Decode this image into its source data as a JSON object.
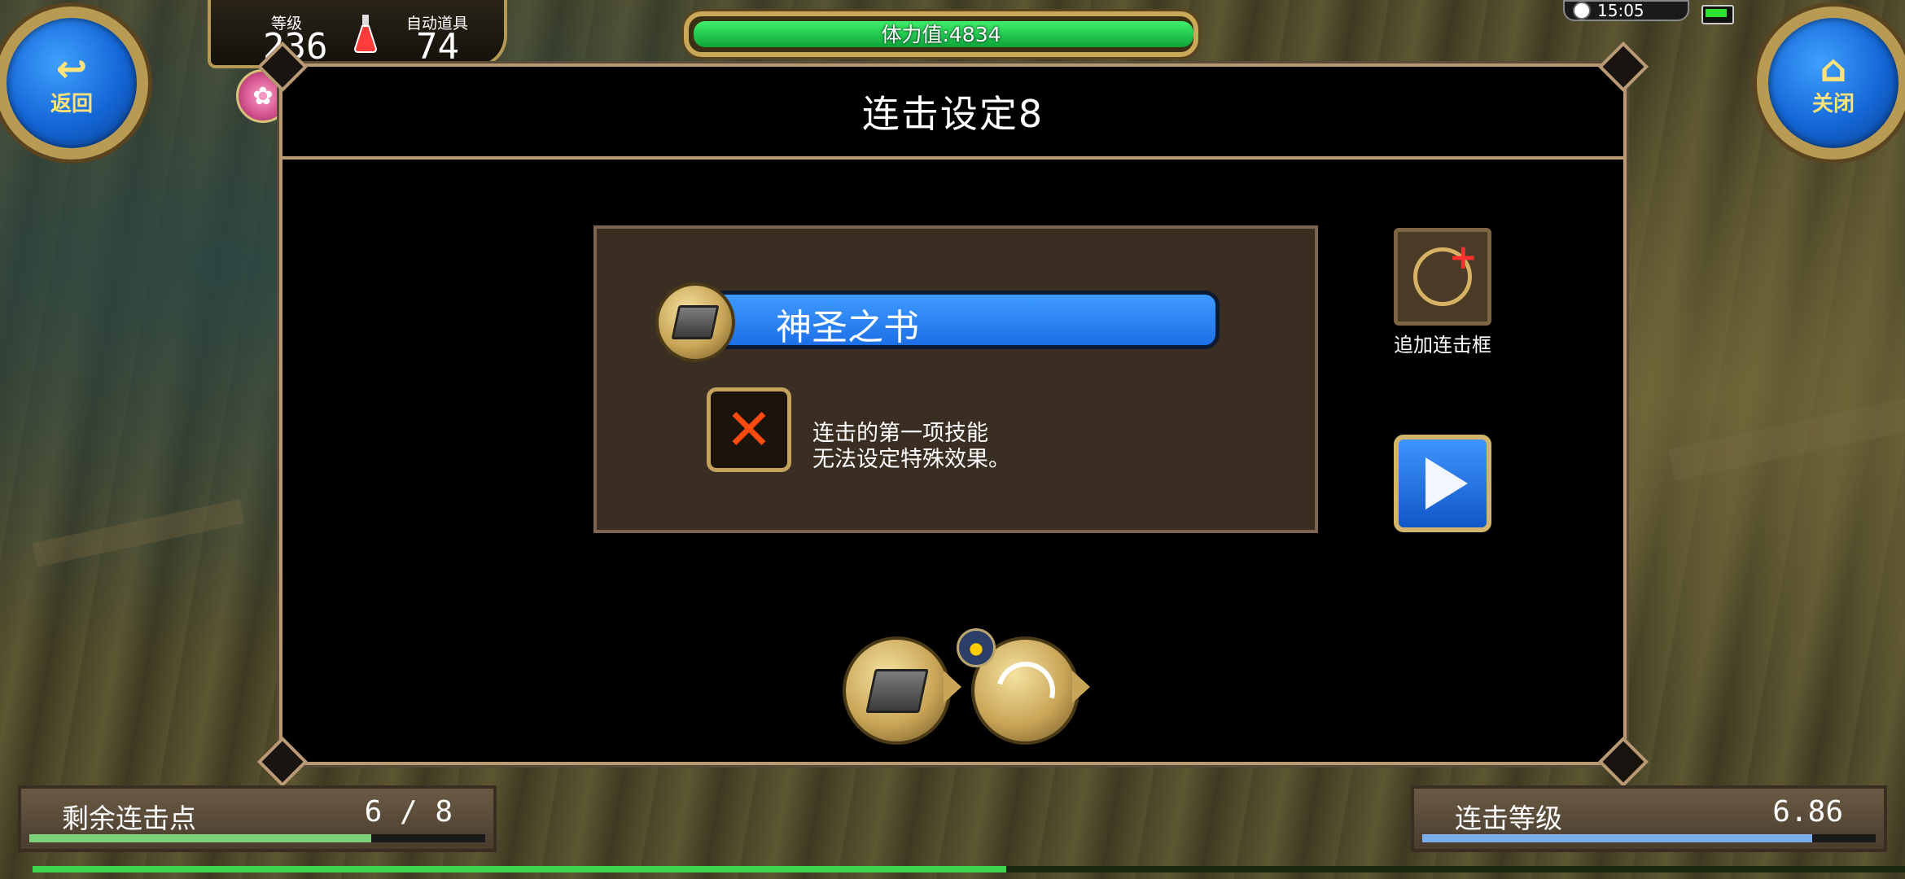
{
  "nav": {
    "back_label": "返回",
    "close_label": "关闭"
  },
  "hud": {
    "level_label": "等级",
    "level_value": "236",
    "auto_item_label": "自动道具",
    "auto_item_value": "74",
    "stamina_text": "体力值:4834",
    "stamina_fraction": 1.0,
    "clock": "15:05"
  },
  "dialog": {
    "title": "连击设定8",
    "skill_name": "神圣之书",
    "note_line1": "连击的第一项技能",
    "note_line2": "无法设定特殊效果。",
    "add_combo_label": "追加连击框"
  },
  "combo_slots": [
    {
      "icon": "book-icon"
    },
    {
      "icon": "slash-skill-icon"
    }
  ],
  "bottom": {
    "remaining_label": "剩余连击点",
    "remaining_value": "6 / 8",
    "remaining_fraction": 0.75,
    "combo_level_label": "连击等级",
    "combo_level_value": "6.86",
    "combo_level_fraction": 0.86,
    "exp_fraction": 0.52
  },
  "colors": {
    "accent_gold": "#b99a74",
    "skill_blue": "#1c6fe6",
    "stamina_green": "#0fa43a",
    "remaining_fill": "#7fd07a",
    "combo_level_fill": "#7aaeea"
  }
}
